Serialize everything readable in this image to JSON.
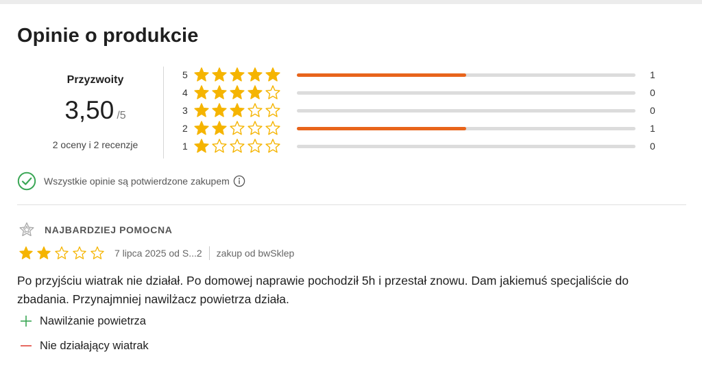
{
  "section": {
    "title": "Opinie o produkcie"
  },
  "summary": {
    "label": "Przyzwoity",
    "score": "3,50",
    "score_max": "/5",
    "count_text": "2 oceny i 2 recenzje"
  },
  "distribution": [
    {
      "stars": "5",
      "count": "1",
      "fraction": 0.5
    },
    {
      "stars": "4",
      "count": "0",
      "fraction": 0
    },
    {
      "stars": "3",
      "count": "0",
      "fraction": 0
    },
    {
      "stars": "2",
      "count": "1",
      "fraction": 0.5
    },
    {
      "stars": "1",
      "count": "0",
      "fraction": 0
    }
  ],
  "verified": {
    "text": "Wszystkie opinie są potwierdzone zakupem",
    "icon": "check-circle-icon",
    "info_icon": "info-icon"
  },
  "review": {
    "badge": "NAJBARDZIEJ POMOCNA",
    "badge_icon": "star-outline-icon",
    "rating": 2,
    "date_author": "7 lipca 2025 od S...2",
    "store": "zakup od bwSklep",
    "text": "Po przyjściu wiatrak nie działał. Po domowej naprawie pochodził 5h i przestał znowu. Dam jakiemuś specjaliście do zbadania. Przynajmniej nawilżacz powietrza działa.",
    "pro": "Nawilżanie powietrza",
    "con": "Nie działający wiatrak"
  },
  "colors": {
    "star": "#f5b400",
    "bar_fill": "#e8641b",
    "bar_track": "#dcdcdc",
    "verified_green": "#3aa655",
    "pro_green": "#3aa655",
    "con_red": "#e0443a"
  }
}
